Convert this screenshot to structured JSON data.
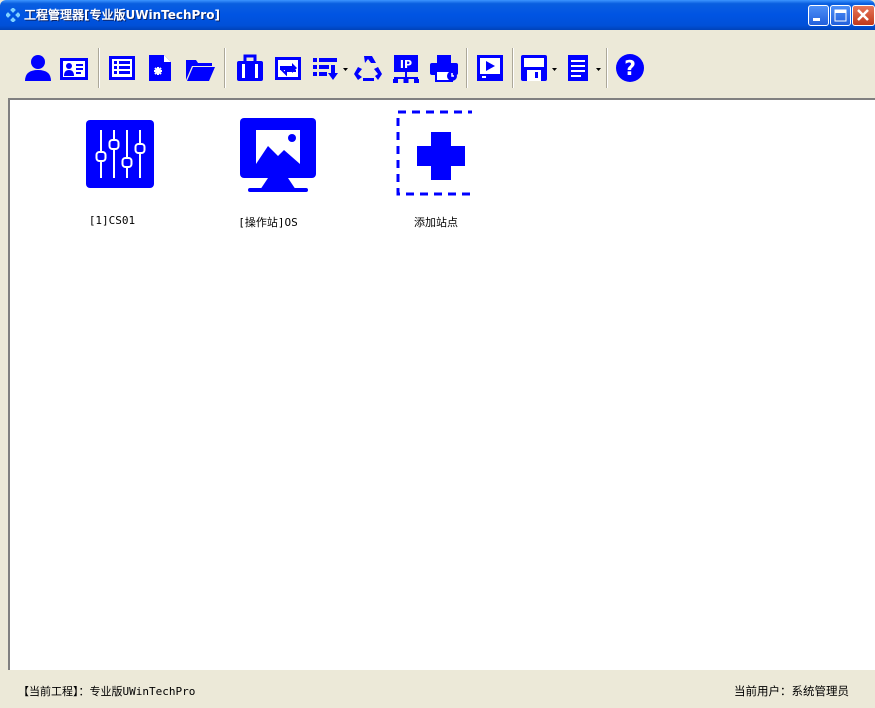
{
  "window": {
    "title": "工程管理器[专业版UWinTechPro]",
    "accent": "#0054e3"
  },
  "toolbar": {
    "icon_color": "#0000ff",
    "buttons": [
      {
        "icon": "user-icon"
      },
      {
        "icon": "id-card-icon"
      },
      {
        "icon": "list-icon"
      },
      {
        "icon": "new-file-icon"
      },
      {
        "icon": "open-folder-icon"
      },
      {
        "icon": "clipboard-icon"
      },
      {
        "icon": "transfer-icon"
      },
      {
        "icon": "download-list-icon"
      },
      {
        "icon": "recycle-icon"
      },
      {
        "icon": "ip-network-icon"
      },
      {
        "icon": "print-icon"
      },
      {
        "icon": "play-icon"
      },
      {
        "icon": "save-icon"
      },
      {
        "icon": "document-icon"
      },
      {
        "icon": "help-icon"
      }
    ]
  },
  "stations": [
    {
      "label": "[1]CS01",
      "icon": "controller-icon"
    },
    {
      "label": "[操作站]OS",
      "icon": "monitor-image-icon"
    },
    {
      "label": "添加站点",
      "icon": "add-station-icon"
    }
  ],
  "status": {
    "left": "【当前工程】：专业版UWinTechPro",
    "right": "当前用户：系统管理员"
  }
}
